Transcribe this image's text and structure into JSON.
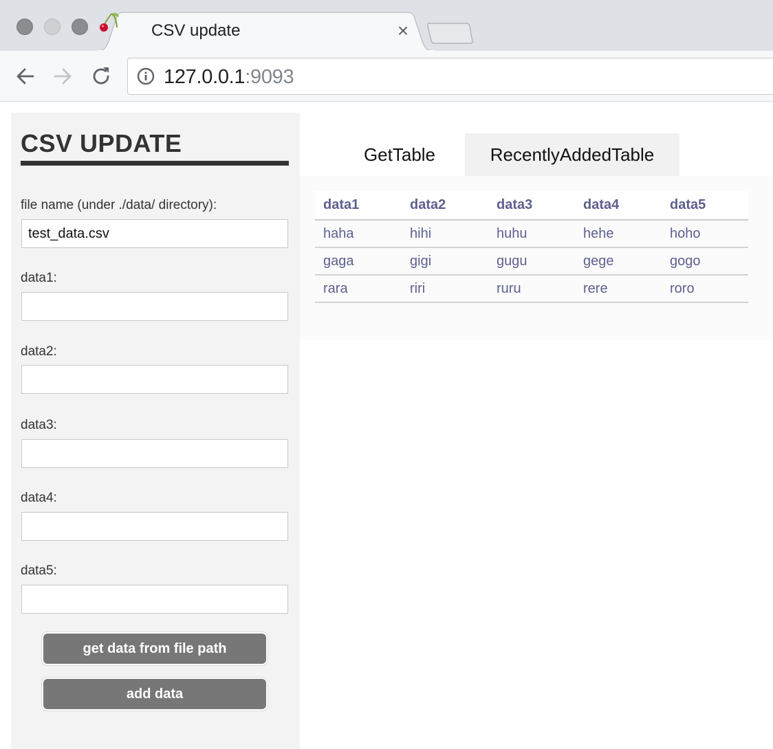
{
  "browser": {
    "tab_title": "CSV update",
    "url_host": "127.0.0.1",
    "url_port": ":9093"
  },
  "sidebar": {
    "title": "CSV UPDATE",
    "file_label": "file name (under ./data/ directory):",
    "file_value": "test_data.csv",
    "fields": [
      {
        "label": "data1:",
        "value": ""
      },
      {
        "label": "data2:",
        "value": ""
      },
      {
        "label": "data3:",
        "value": ""
      },
      {
        "label": "data4:",
        "value": ""
      },
      {
        "label": "data5:",
        "value": ""
      }
    ],
    "get_button": "get data from file path",
    "add_button": "add data"
  },
  "tabs": [
    {
      "label": "GetTable"
    },
    {
      "label": "RecentlyAddedTable"
    }
  ],
  "table": {
    "headers": [
      "data1",
      "data2",
      "data3",
      "data4",
      "data5"
    ],
    "rows": [
      [
        "haha",
        "hihi",
        "huhu",
        "hehe",
        "hoho"
      ],
      [
        "gaga",
        "gigi",
        "gugu",
        "gege",
        "gogo"
      ],
      [
        "rara",
        "riri",
        "ruru",
        "rere",
        "roro"
      ]
    ]
  },
  "colors": {
    "sidebar_bg": "#f3f3f3",
    "button_bg": "#777777",
    "table_text": "#5d5f8f",
    "title_text": "#333333"
  },
  "icons": {
    "favicon": "cherry-icon",
    "back": "arrow-left-icon",
    "forward": "arrow-right-icon",
    "reload": "reload-icon",
    "info": "info-circle-icon",
    "close": "close-icon"
  }
}
